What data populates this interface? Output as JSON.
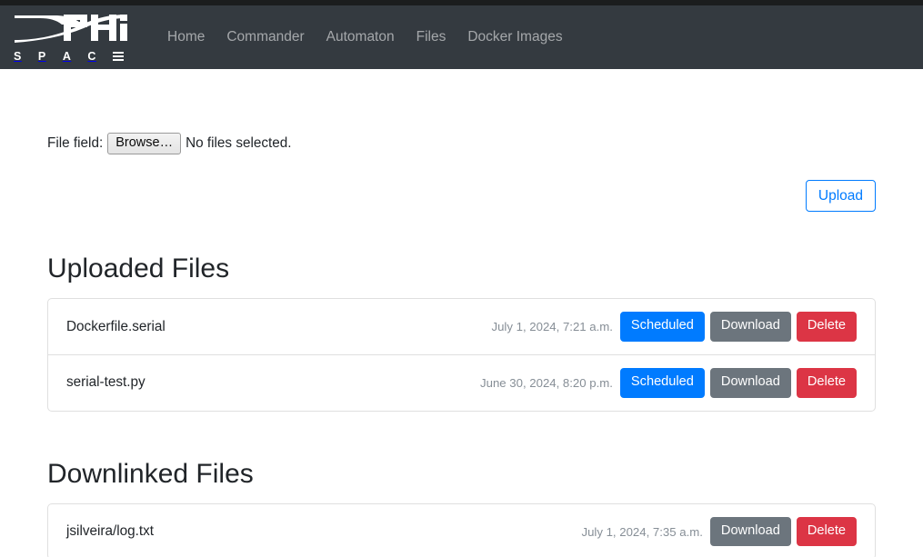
{
  "browser": {
    "top_strip_color": "#1b1d1e"
  },
  "navbar": {
    "background": "#343a40",
    "brand": {
      "name": "DPHI",
      "sub_letters": [
        "S",
        "P",
        "A",
        "C"
      ],
      "sub_last_icon": "hamburger-bars-icon",
      "full_text": "DPHI SPACE"
    },
    "links": [
      {
        "label": "Home"
      },
      {
        "label": "Commander"
      },
      {
        "label": "Automaton"
      },
      {
        "label": "Files"
      },
      {
        "label": "Docker Images"
      }
    ]
  },
  "upload_form": {
    "file_field_label": "File field:",
    "browse_button": "Browse…",
    "no_files_text": "No files selected.",
    "upload_button": "Upload",
    "upload_button_color": "#007bff"
  },
  "sections": [
    {
      "title": "Uploaded Files",
      "items": [
        {
          "name": "Dockerfile.serial",
          "timestamp": "July 1, 2024, 7:21 a.m.",
          "buttons": [
            {
              "label": "Scheduled",
              "style": "btn-primary",
              "color": "#007bff"
            },
            {
              "label": "Download",
              "style": "btn-secondary",
              "color": "#6c757d"
            },
            {
              "label": "Delete",
              "style": "btn-danger",
              "color": "#dc3545"
            }
          ]
        },
        {
          "name": "serial-test.py",
          "timestamp": "June 30, 2024, 8:20 p.m.",
          "buttons": [
            {
              "label": "Scheduled",
              "style": "btn-primary",
              "color": "#007bff"
            },
            {
              "label": "Download",
              "style": "btn-secondary",
              "color": "#6c757d"
            },
            {
              "label": "Delete",
              "style": "btn-danger",
              "color": "#dc3545"
            }
          ]
        }
      ]
    },
    {
      "title": "Downlinked Files",
      "items": [
        {
          "name": "jsilveira/log.txt",
          "timestamp": "July 1, 2024, 7:35 a.m.",
          "buttons": [
            {
              "label": "Download",
              "style": "btn-secondary",
              "color": "#6c757d"
            },
            {
              "label": "Delete",
              "style": "btn-danger",
              "color": "#dc3545"
            }
          ]
        }
      ]
    }
  ]
}
